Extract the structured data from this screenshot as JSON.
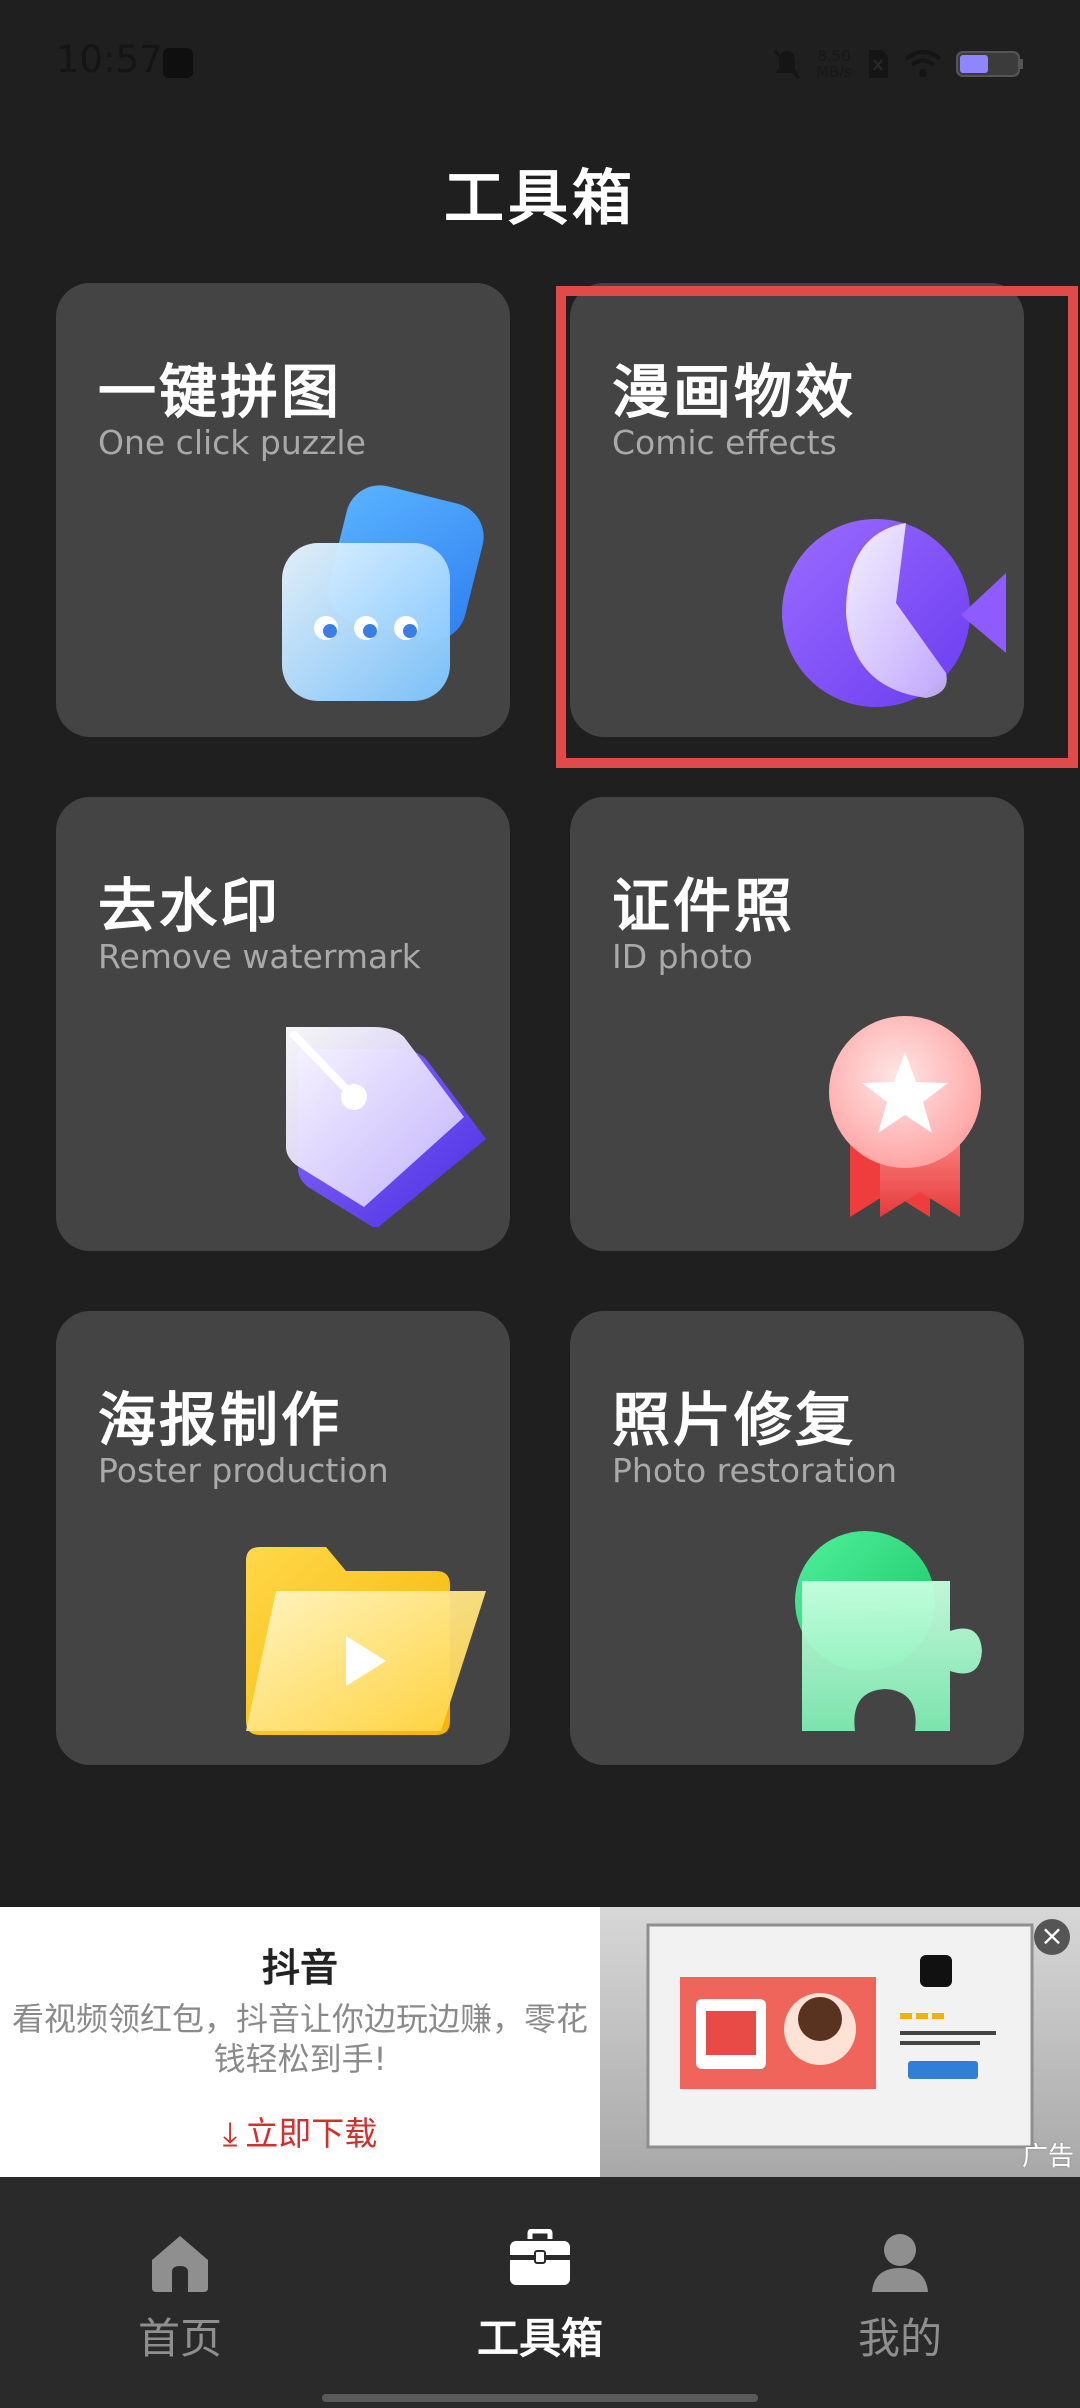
{
  "status_bar": {
    "time": "10:57",
    "speed_value": "8.50",
    "speed_unit": "MB/s",
    "icons": [
      "app-notification-icon",
      "mute-icon",
      "sim-icon",
      "wifi-icon",
      "battery-icon"
    ]
  },
  "page": {
    "title": "工具箱"
  },
  "tools": [
    {
      "title": "一键拼图",
      "subtitle": "One click puzzle",
      "icon": "chat-bubble-icon"
    },
    {
      "title": "漫画物效",
      "subtitle": "Comic effects",
      "icon": "comic-shapes-icon"
    },
    {
      "title": "去水印",
      "subtitle": "Remove watermark",
      "icon": "pen-nib-icon"
    },
    {
      "title": "证件照",
      "subtitle": "ID photo",
      "icon": "award-medal-icon"
    },
    {
      "title": "海报制作",
      "subtitle": "Poster production",
      "icon": "video-folder-icon"
    },
    {
      "title": "照片修复",
      "subtitle": "Photo restoration",
      "icon": "puzzle-piece-icon"
    }
  ],
  "ad": {
    "app_name": "抖音",
    "description": "看视频领红包，抖音让你边玩边赚，零花钱轻松到手!",
    "cta": "立即下载",
    "label": "广告",
    "close": "×"
  },
  "nav": [
    {
      "label": "首页",
      "icon": "home-icon",
      "active": false
    },
    {
      "label": "工具箱",
      "icon": "toolbox-icon",
      "active": true
    },
    {
      "label": "我的",
      "icon": "profile-icon",
      "active": false
    }
  ],
  "colors": {
    "background": "#1f1f1f",
    "card": "#444444",
    "highlight": "#e24a4a",
    "cta": "#d0302e"
  }
}
